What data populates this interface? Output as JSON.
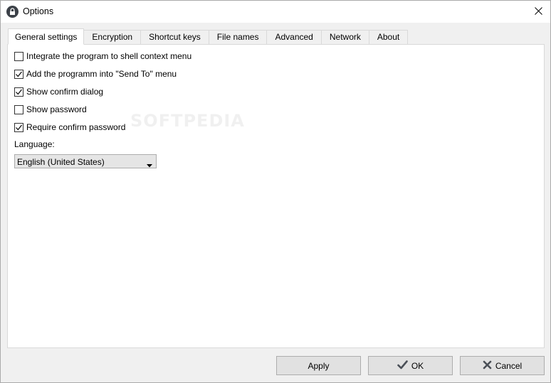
{
  "window": {
    "title": "Options"
  },
  "tabs": [
    {
      "label": "General settings",
      "active": true
    },
    {
      "label": "Encryption",
      "active": false
    },
    {
      "label": "Shortcut keys",
      "active": false
    },
    {
      "label": "File names",
      "active": false
    },
    {
      "label": "Advanced",
      "active": false
    },
    {
      "label": "Network",
      "active": false
    },
    {
      "label": "About",
      "active": false
    }
  ],
  "general": {
    "options": [
      {
        "label": "Integrate the program to shell context menu",
        "checked": false
      },
      {
        "label": "Add the programm into \"Send To\" menu",
        "checked": true
      },
      {
        "label": "Show confirm dialog",
        "checked": true
      },
      {
        "label": "Show password",
        "checked": false
      },
      {
        "label": "Require confirm password",
        "checked": true
      }
    ],
    "language_label": "Language:",
    "language_value": "English (United States)"
  },
  "buttons": {
    "apply": "Apply",
    "ok": "OK",
    "cancel": "Cancel"
  },
  "icons": {
    "app": "lock-icon",
    "close": "close-icon",
    "ok": "checkmark-icon",
    "cancel": "x-icon",
    "dropdown": "chevron-down-icon"
  },
  "watermark": "SOFTPEDIA"
}
